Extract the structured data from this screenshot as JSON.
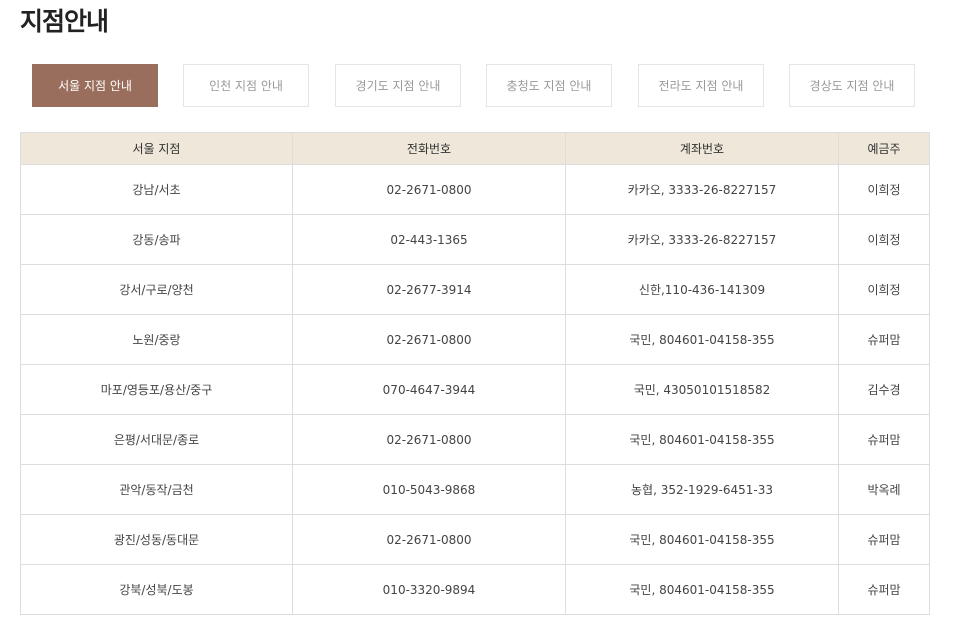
{
  "page": {
    "title": "지점안내"
  },
  "tabs": [
    {
      "label": "서울 지점 안내",
      "active": true
    },
    {
      "label": "인천 지점 안내",
      "active": false
    },
    {
      "label": "경기도 지점 안내",
      "active": false
    },
    {
      "label": "충청도 지점 안내",
      "active": false
    },
    {
      "label": "전라도 지점 안내",
      "active": false
    },
    {
      "label": "경상도 지점 안내",
      "active": false
    }
  ],
  "table": {
    "headers": [
      "서울 지점",
      "전화번호",
      "계좌번호",
      "예금주"
    ],
    "rows": [
      [
        "강남/서초",
        "02-2671-0800",
        "카카오, 3333-26-8227157",
        "이희정"
      ],
      [
        "강동/송파",
        "02-443-1365",
        "카카오, 3333-26-8227157",
        "이희정"
      ],
      [
        "강서/구로/양천",
        "02-2677-3914",
        "신한,110-436-141309",
        "이희정"
      ],
      [
        "노원/중랑",
        "02-2671-0800",
        "국민, 804601-04158-355",
        "슈퍼맘"
      ],
      [
        "마포/영등포/용산/중구",
        "070-4647-3944",
        "국민, 43050101518582",
        "김수경"
      ],
      [
        "은평/서대문/종로",
        "02-2671-0800",
        "국민, 804601-04158-355",
        "슈퍼맘"
      ],
      [
        "관악/동작/금천",
        "010-5043-9868",
        "농협, 352-1929-6451-33",
        "박옥례"
      ],
      [
        "광진/성동/동대문",
        "02-2671-0800",
        "국민, 804601-04158-355",
        "슈퍼맘"
      ],
      [
        "강북/성북/도봉",
        "010-3320-9894",
        "국민, 804601-04158-355",
        "슈퍼맘"
      ]
    ]
  },
  "colors": {
    "active_tab": "#9a6e5c",
    "header_background": "#efe7da",
    "border": "#dddddd"
  }
}
